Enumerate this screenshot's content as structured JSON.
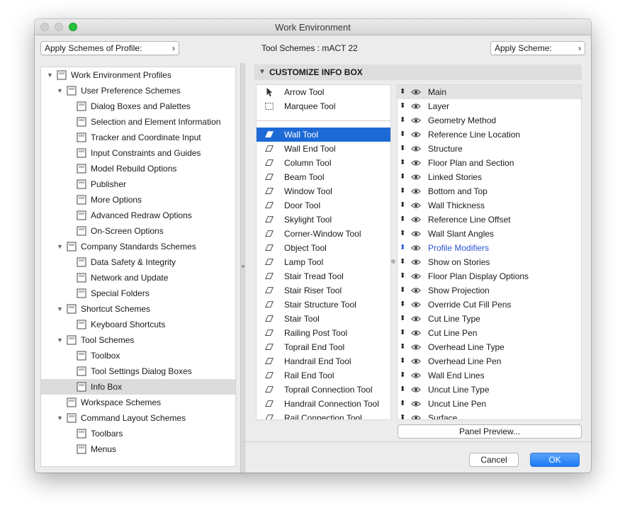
{
  "window": {
    "title": "Work Environment"
  },
  "top": {
    "apply_profile": "Apply Schemes of Profile:",
    "tool_schemes_label": "Tool Schemes :  mACT 22",
    "apply_scheme": "Apply Scheme:"
  },
  "tree": [
    {
      "label": "Work Environment Profiles",
      "level": 0,
      "expanded": true,
      "icon": "profile-icon"
    },
    {
      "label": "User Preference Schemes",
      "level": 1,
      "expanded": true,
      "icon": "user-prefs-icon"
    },
    {
      "label": "Dialog Boxes and Palettes",
      "level": 2,
      "icon": "dialog-icon"
    },
    {
      "label": "Selection and Element Information",
      "level": 2,
      "icon": "selection-icon"
    },
    {
      "label": "Tracker and Coordinate Input",
      "level": 2,
      "icon": "xyz-icon"
    },
    {
      "label": "Input Constraints and Guides",
      "level": 2,
      "icon": "mouse-icon"
    },
    {
      "label": "Model Rebuild Options",
      "level": 2,
      "icon": "bricks-icon"
    },
    {
      "label": "Publisher",
      "level": 2,
      "icon": "publisher-icon"
    },
    {
      "label": "More Options",
      "level": 2,
      "icon": "sliders-icon"
    },
    {
      "label": "Advanced Redraw Options",
      "level": 2,
      "icon": "redraw-icon"
    },
    {
      "label": "On-Screen Options",
      "level": 2,
      "icon": "screen-icon"
    },
    {
      "label": "Company Standards Schemes",
      "level": 1,
      "expanded": true,
      "icon": "company-icon"
    },
    {
      "label": "Data Safety & Integrity",
      "level": 2,
      "icon": "safety-icon"
    },
    {
      "label": "Network and Update",
      "level": 2,
      "icon": "network-icon"
    },
    {
      "label": "Special Folders",
      "level": 2,
      "icon": "folder-icon"
    },
    {
      "label": "Shortcut Schemes",
      "level": 1,
      "expanded": true,
      "icon": "shortcut-icon"
    },
    {
      "label": "Keyboard Shortcuts",
      "level": 2,
      "icon": "keyboard-icon"
    },
    {
      "label": "Tool Schemes",
      "level": 1,
      "expanded": true,
      "icon": "tool-schemes-icon"
    },
    {
      "label": "Toolbox",
      "level": 2,
      "icon": "toolbox-icon"
    },
    {
      "label": "Tool Settings Dialog Boxes",
      "level": 2,
      "icon": "tool-settings-icon"
    },
    {
      "label": "Info Box",
      "level": 2,
      "icon": "info-box-icon",
      "selected": true
    },
    {
      "label": "Workspace Schemes",
      "level": 1,
      "icon": "workspace-icon"
    },
    {
      "label": "Command Layout Schemes",
      "level": 1,
      "expanded": true,
      "icon": "command-layout-icon"
    },
    {
      "label": "Toolbars",
      "level": 2,
      "icon": "toolbars-icon"
    },
    {
      "label": "Menus",
      "level": 2,
      "icon": "menus-icon"
    }
  ],
  "right": {
    "header": "CUSTOMIZE INFO BOX",
    "tools_top": [
      {
        "label": "Arrow Tool",
        "icon": "arrow-tool-icon"
      },
      {
        "label": "Marquee Tool",
        "icon": "marquee-tool-icon"
      }
    ],
    "tools": [
      {
        "label": "Wall Tool",
        "icon": "wall-tool-icon",
        "selected": true
      },
      {
        "label": "Wall End Tool",
        "icon": "wall-end-tool-icon"
      },
      {
        "label": "Column Tool",
        "icon": "column-tool-icon"
      },
      {
        "label": "Beam Tool",
        "icon": "beam-tool-icon"
      },
      {
        "label": "Window Tool",
        "icon": "window-tool-icon"
      },
      {
        "label": "Door Tool",
        "icon": "door-tool-icon"
      },
      {
        "label": "Skylight Tool",
        "icon": "skylight-tool-icon"
      },
      {
        "label": "Corner-Window Tool",
        "icon": "corner-window-tool-icon"
      },
      {
        "label": "Object Tool",
        "icon": "object-tool-icon"
      },
      {
        "label": "Lamp Tool",
        "icon": "lamp-tool-icon"
      },
      {
        "label": "Stair Tread Tool",
        "icon": "stair-tread-tool-icon"
      },
      {
        "label": "Stair Riser Tool",
        "icon": "stair-riser-tool-icon"
      },
      {
        "label": "Stair Structure Tool",
        "icon": "stair-structure-tool-icon"
      },
      {
        "label": "Stair Tool",
        "icon": "stair-tool-icon"
      },
      {
        "label": "Railing Post Tool",
        "icon": "railing-post-tool-icon"
      },
      {
        "label": "Toprail End Tool",
        "icon": "toprail-end-tool-icon"
      },
      {
        "label": "Handrail End Tool",
        "icon": "handrail-end-tool-icon"
      },
      {
        "label": "Rail End Tool",
        "icon": "rail-end-tool-icon"
      },
      {
        "label": "Toprail Connection Tool",
        "icon": "toprail-connection-tool-icon"
      },
      {
        "label": "Handrail Connection Tool",
        "icon": "handrail-connection-tool-icon"
      },
      {
        "label": "Rail Connection Tool",
        "icon": "rail-connection-tool-icon"
      }
    ],
    "panels": [
      {
        "label": "Main",
        "selected": true
      },
      {
        "label": "Layer"
      },
      {
        "label": "Geometry Method"
      },
      {
        "label": "Reference Line Location"
      },
      {
        "label": "Structure"
      },
      {
        "label": "Floor Plan and Section"
      },
      {
        "label": "Linked Stories"
      },
      {
        "label": "Bottom and Top"
      },
      {
        "label": "Wall Thickness"
      },
      {
        "label": "Reference Line Offset"
      },
      {
        "label": "Wall Slant Angles"
      },
      {
        "label": "Profile Modifiers",
        "highlight": true
      },
      {
        "label": "Show on Stories"
      },
      {
        "label": "Floor Plan Display Options"
      },
      {
        "label": "Show Projection"
      },
      {
        "label": "Override Cut Fill Pens"
      },
      {
        "label": "Cut Line Type"
      },
      {
        "label": "Cut Line Pen"
      },
      {
        "label": "Overhead Line Type"
      },
      {
        "label": "Overhead Line Pen"
      },
      {
        "label": "Wall End Lines"
      },
      {
        "label": "Uncut Line Type"
      },
      {
        "label": "Uncut Line Pen"
      },
      {
        "label": "Surface"
      }
    ],
    "panel_preview": "Panel Preview..."
  },
  "buttons": {
    "cancel": "Cancel",
    "ok": "OK"
  },
  "colors": {
    "selection_blue": "#1d6ad6",
    "ok_blue": "#1d7bf4",
    "highlight_text": "#2b55d6"
  }
}
